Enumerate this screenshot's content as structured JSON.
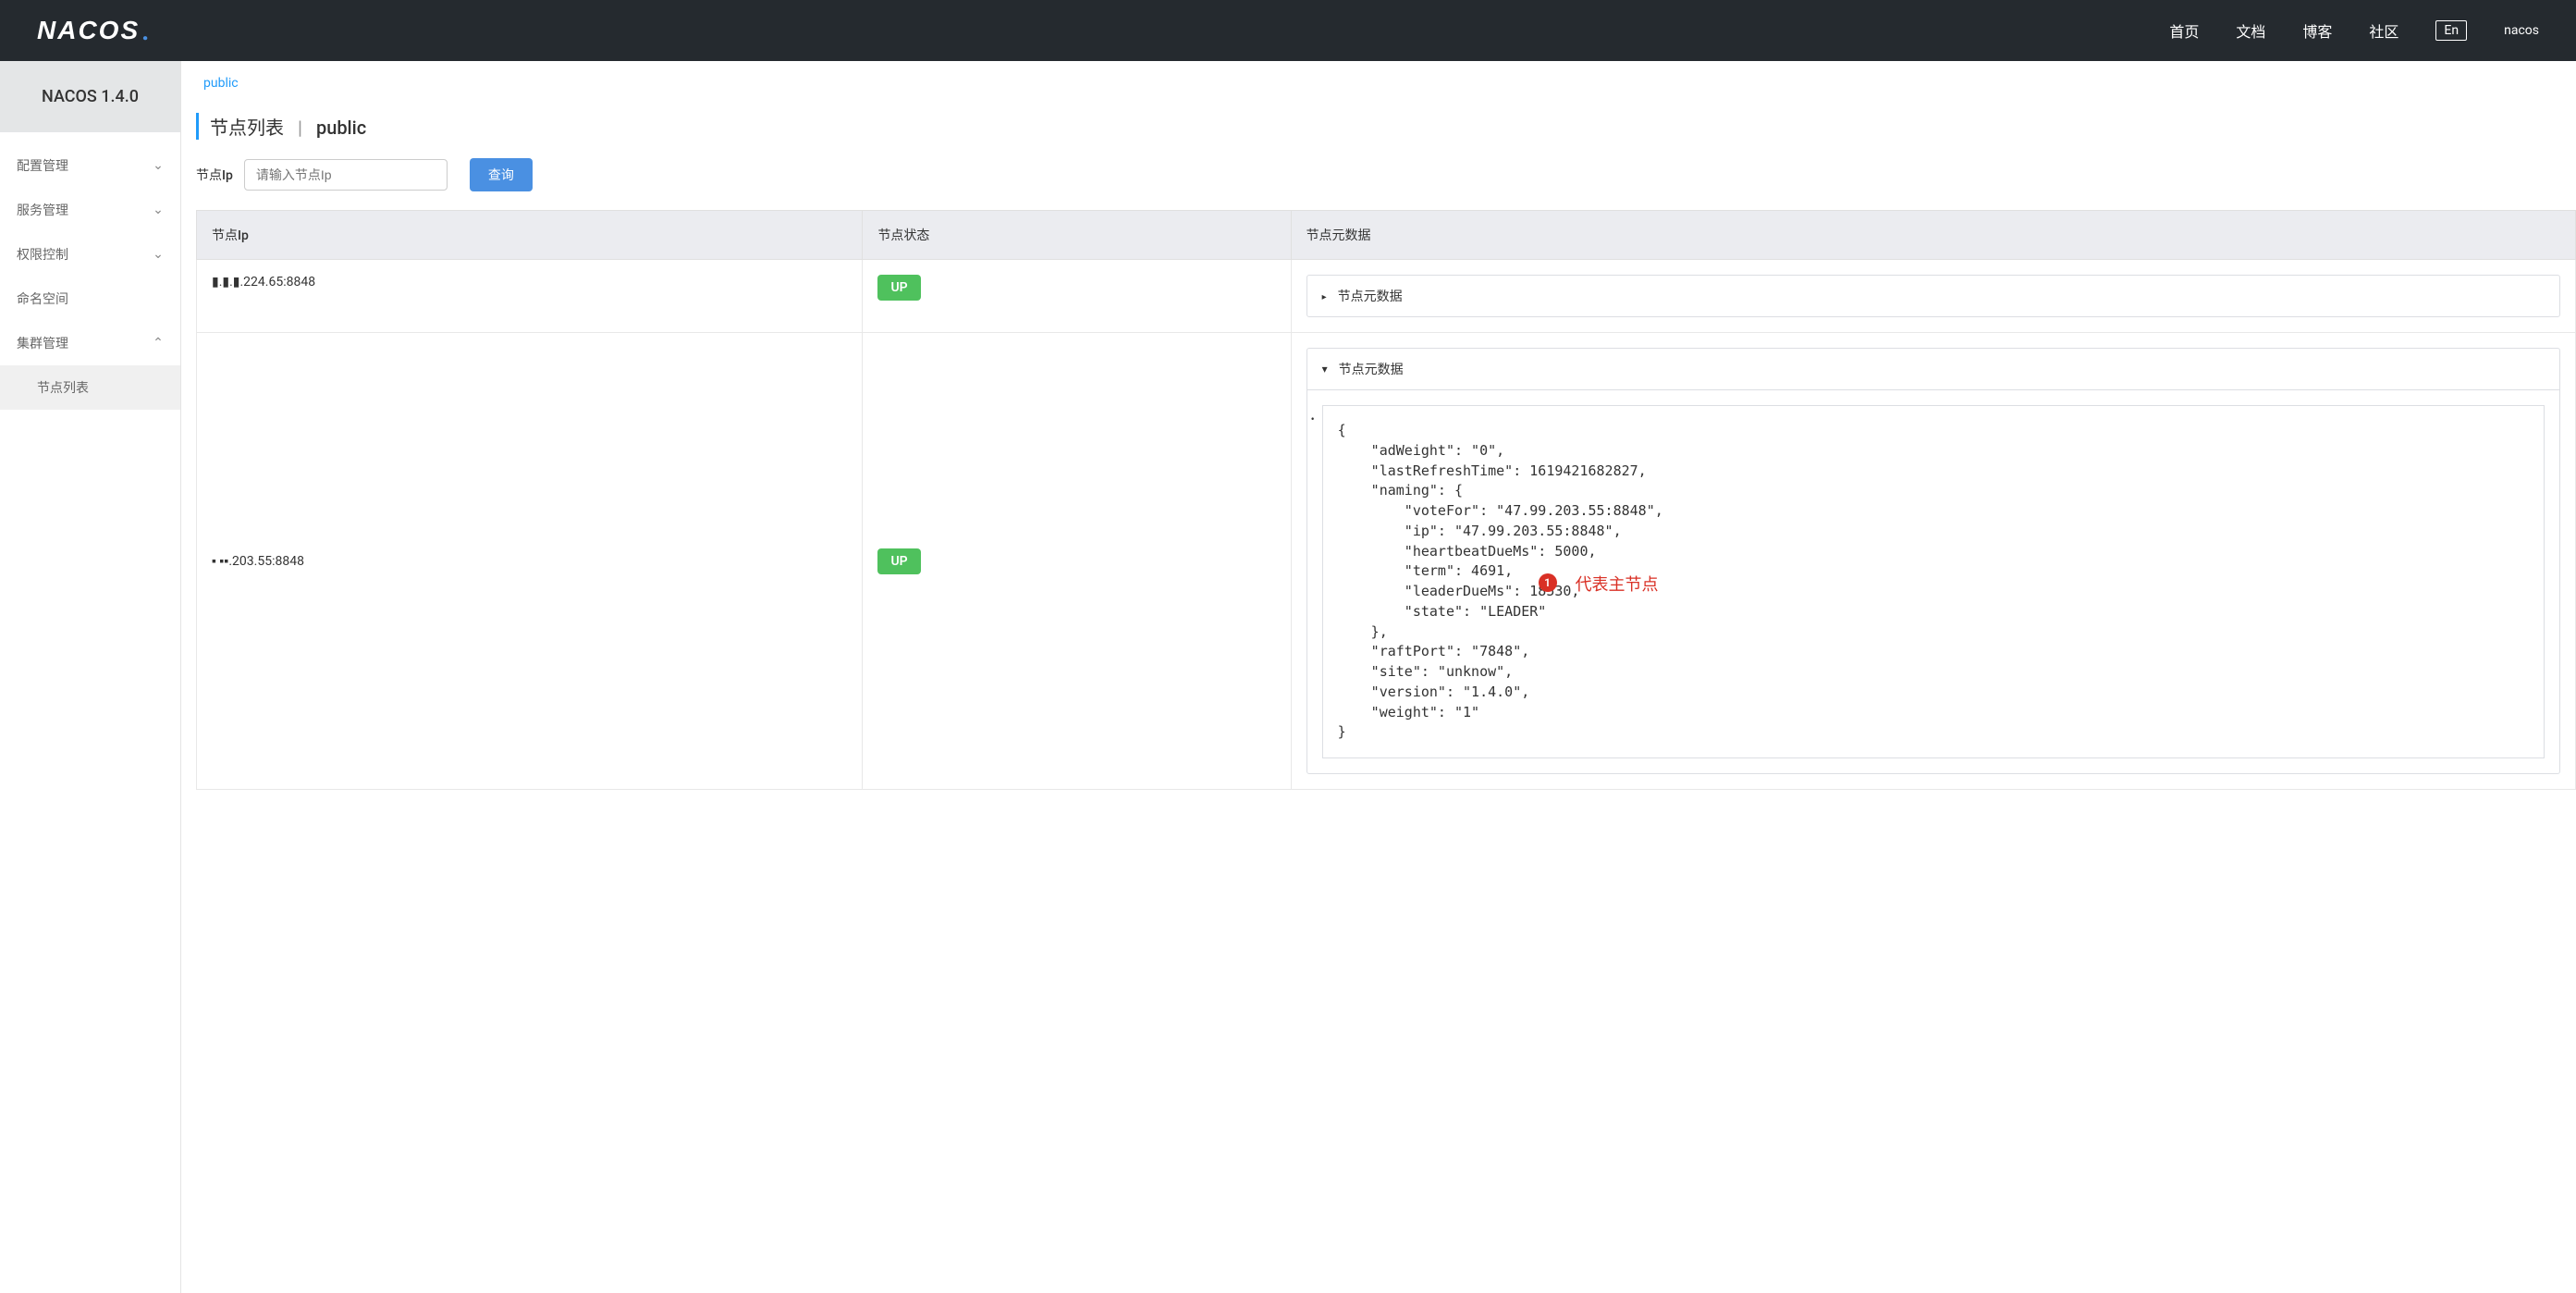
{
  "header": {
    "logo_text": "NACOS",
    "nav": {
      "home": "首页",
      "docs": "文档",
      "blog": "博客",
      "community": "社区"
    },
    "lang": "En",
    "user": "nacos"
  },
  "sidebar": {
    "brand": "NACOS 1.4.0",
    "items": {
      "config": "配置管理",
      "service": "服务管理",
      "auth": "权限控制",
      "namespace": "命名空间",
      "cluster": "集群管理"
    },
    "sub": {
      "node_list": "节点列表"
    }
  },
  "namespace_tab": "public",
  "page_title": {
    "main": "节点列表",
    "ns": "public"
  },
  "search": {
    "label": "节点Ip",
    "placeholder": "请输入节点Ip",
    "button": "查询"
  },
  "table": {
    "headers": {
      "ip": "节点Ip",
      "status": "节点状态",
      "meta": "节点元数据"
    },
    "rows": [
      {
        "ip": "▮.▮.▮.224.65:8848",
        "status": "UP",
        "meta_title": "节点元数据",
        "expanded": false
      },
      {
        "ip": "▪ ▪▪.203.55:8848",
        "status": "UP",
        "meta_title": "节点元数据",
        "expanded": true,
        "json": "{\n    \"adWeight\": \"0\",\n    \"lastRefreshTime\": 1619421682827,\n    \"naming\": {\n        \"voteFor\": \"47.99.203.55:8848\",\n        \"ip\": \"47.99.203.55:8848\",\n        \"heartbeatDueMs\": 5000,\n        \"term\": 4691,\n        \"leaderDueMs\": 18530,\n        \"state\": \"LEADER\"\n    },\n    \"raftPort\": \"7848\",\n    \"site\": \"unknow\",\n    \"version\": \"1.4.0\",\n    \"weight\": \"1\"\n}"
      }
    ]
  },
  "annotation": {
    "num": "1",
    "text": "代表主节点"
  }
}
